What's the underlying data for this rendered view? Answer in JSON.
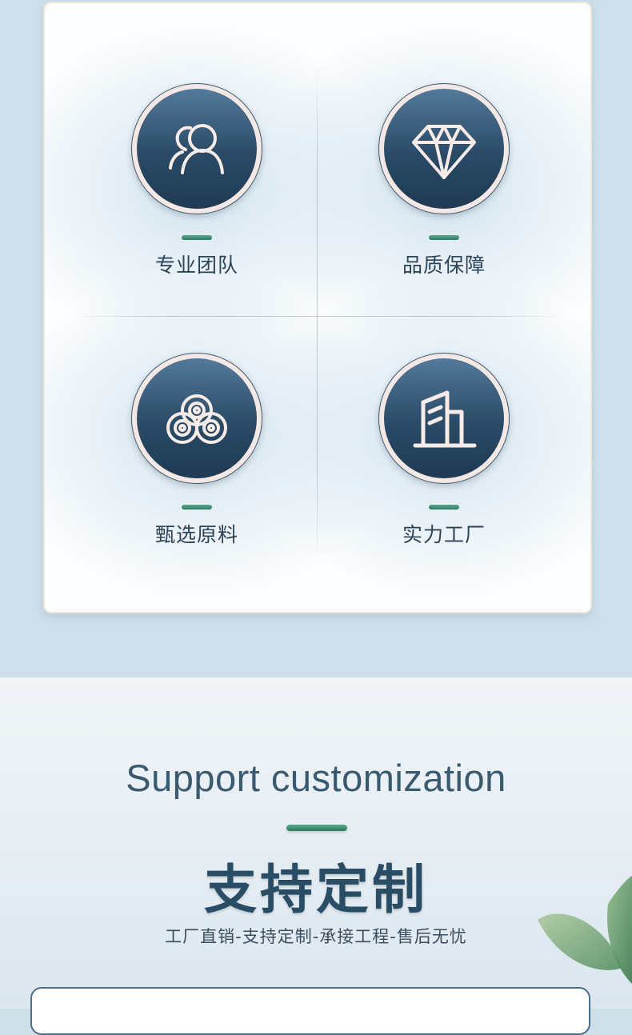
{
  "features": [
    {
      "label": "专业团队",
      "icon": "team-icon"
    },
    {
      "label": "品质保障",
      "icon": "diamond-icon"
    },
    {
      "label": "甄选原料",
      "icon": "material-rolls-icon"
    },
    {
      "label": "实力工厂",
      "icon": "factory-building-icon"
    }
  ],
  "customization": {
    "title_en": "Support customization",
    "title_zh": "支持定制",
    "subtitle": "工厂直销-支持定制-承接工程-售后无忧"
  },
  "colors": {
    "accent_green": "#2f7a61",
    "navy": "#2a4a66",
    "background": "#cddfea"
  }
}
